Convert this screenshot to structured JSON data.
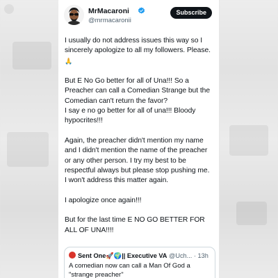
{
  "colors": {
    "background": "#e7e7e7",
    "card": "#ffffff",
    "text": "#0f1419",
    "muted": "#536471",
    "verified": "#1d9bf0",
    "subscribe_bg": "#0f1419"
  },
  "author": {
    "display_name": "MrMacaroni",
    "handle": "@mrmacaronii",
    "verified_icon": "verified-badge-icon"
  },
  "subscribe_label": "Subscribe",
  "tweet": {
    "p1": [
      "I usually do not address issues this way so I",
      "sincerely apologize to all my followers. Please."
    ],
    "p1_emoji": "🙏",
    "p2": [
      "But E No Go better for all of Una!!! So a",
      "Preacher can call a Comedian Strange but the",
      "Comedian can't return the favor?",
      "I say e no go better for all of una!!! Bloody",
      "hypocrites!!!"
    ],
    "p3": [
      "Again, the preacher didn't mention my name",
      "and I didn't mention the name of the preacher",
      "or any other person. I try my best to be",
      "respectful always but please stop pushing me.",
      "I won't address this matter again."
    ],
    "p4": [
      "I apologize once again!!!"
    ],
    "p5": [
      "But for the last time E NO GO BETTER FOR",
      "ALL OF UNA!!!!"
    ]
  },
  "quoted": {
    "name": "Sent One🚀🌍|| Executive VA",
    "handle_time": "@Uch... · 13h",
    "text_line1": "A comedian now can call a Man Of God a",
    "text_line2": "\"strange preacher\""
  }
}
